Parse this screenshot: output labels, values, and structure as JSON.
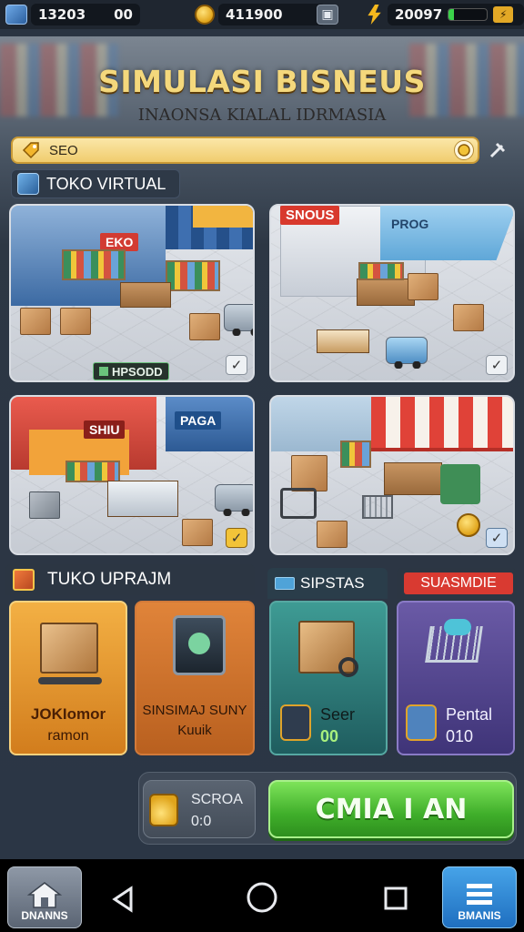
{
  "status_bar": {
    "resource_1": "13203",
    "resource_2": "00",
    "coins": "411900",
    "energy": "20097",
    "energy_level": 0.15
  },
  "header": {
    "title": "SIMULASI BISNEUS",
    "subtitle": "INAONSA KIALAL IDRMASIA"
  },
  "search": {
    "value": "SEO"
  },
  "section_virtual": {
    "label": "TOKO VIRTUAL"
  },
  "stores": [
    {
      "sign": "EKO",
      "tag": "HPSODD"
    },
    {
      "sign": "SNOUS",
      "sign2": "PROG"
    },
    {
      "sign": "SHIU",
      "sign2": "PAGA"
    },
    {
      "sign": ""
    }
  ],
  "bottom_section": {
    "left_header": "TUKO UPRAJM",
    "mid_header": "SIPSTAS",
    "right_header": "SUASMDIE",
    "tile_1": {
      "line1": "JOKIomor",
      "line2": "ramon"
    },
    "tile_2": {
      "line1": "SINSIMAJ SUNY",
      "line2": "Kuuik"
    },
    "tile_3": {
      "label": "Seer",
      "value": "00"
    },
    "tile_4": {
      "label": "Pental",
      "value": "010"
    }
  },
  "action_bar": {
    "score_label": "SCROA",
    "score_value": "0:0",
    "cta_label": "CMIA I AN"
  },
  "nav": {
    "home_label": "DNANNS",
    "menu_label": "BMANIS"
  },
  "colors": {
    "title_gold": "#f4d87c",
    "cta_green": "#3fae2a",
    "tile_orange": "#e0922a",
    "tile_teal": "#2f7d7a",
    "tile_purple": "#5b4a92"
  }
}
